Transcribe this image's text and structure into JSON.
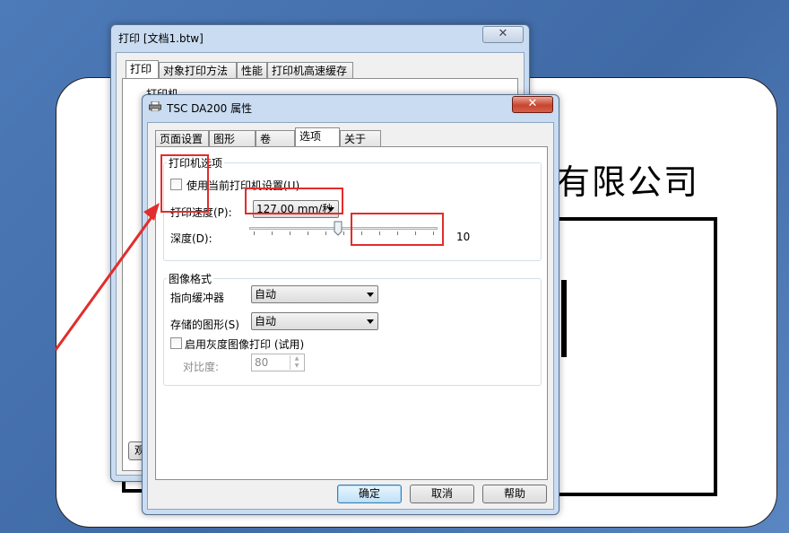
{
  "background_label": {
    "company_text": "有限公司"
  },
  "print_window": {
    "title": "打印 [文档1.btw]",
    "tabs": [
      "打印",
      "对象打印方法",
      "性能",
      "打印机高速缓存"
    ],
    "group_label": "打印机",
    "bottom_button": "观"
  },
  "properties_window": {
    "title": "TSC DA200 属性",
    "tabs": [
      "页面设置",
      "图形",
      "卷",
      "选项",
      "关于"
    ],
    "active_tab": "选项",
    "printer_options": {
      "legend": "打印机选项",
      "use_current_settings_label": "使用当前打印机设置(U)",
      "use_current_settings_checked": false,
      "print_speed_label": "打印速度(P):",
      "print_speed_value": "127.00 mm/秒",
      "depth_label": "深度(D):",
      "depth_value": "10",
      "depth_slider_fraction": 0.47
    },
    "image_format": {
      "legend": "图像格式",
      "pointer_buffer_label": "指向缓冲器",
      "pointer_buffer_value": "自动",
      "stored_graphics_label": "存储的图形(S)",
      "stored_graphics_value": "自动",
      "grayscale_label": "启用灰度图像打印 (试用)",
      "grayscale_checked": false,
      "contrast_label": "对比度:",
      "contrast_value": "80"
    },
    "buttons": {
      "ok": "确定",
      "cancel": "取消",
      "help": "帮助"
    }
  },
  "annotation_color": "#e32c2c"
}
